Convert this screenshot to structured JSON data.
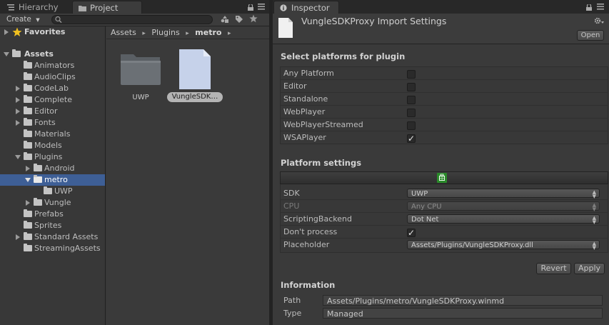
{
  "tabs": {
    "hierarchy": "Hierarchy",
    "project": "Project",
    "inspector": "Inspector"
  },
  "project_toolbar": {
    "create_label": "Create"
  },
  "tree": {
    "favorites": "Favorites",
    "assets": "Assets",
    "items": [
      {
        "label": "Animators"
      },
      {
        "label": "AudioClips"
      },
      {
        "label": "CodeLab"
      },
      {
        "label": "Complete"
      },
      {
        "label": "Editor"
      },
      {
        "label": "Fonts"
      },
      {
        "label": "Materials"
      },
      {
        "label": "Models"
      },
      {
        "label": "Plugins"
      },
      {
        "label": "Android"
      },
      {
        "label": "metro"
      },
      {
        "label": "UWP"
      },
      {
        "label": "Vungle"
      },
      {
        "label": "Prefabs"
      },
      {
        "label": "Sprites"
      },
      {
        "label": "Standard Assets"
      },
      {
        "label": "StreamingAssets"
      }
    ]
  },
  "breadcrumb": {
    "parts": [
      "Assets",
      "Plugins",
      "metro"
    ],
    "separator": "▸"
  },
  "project_items": [
    {
      "label": "UWP",
      "icon": "folder-icon"
    },
    {
      "label": "VungleSDK…",
      "icon": "file-icon",
      "selected": true
    }
  ],
  "inspector": {
    "title": "VungleSDKProxy Import Settings",
    "open_button": "Open",
    "select_platforms_heading": "Select platforms for plugin",
    "platforms": [
      {
        "label": "Any Platform",
        "checked": false
      },
      {
        "label": "Editor",
        "checked": false
      },
      {
        "label": "Standalone",
        "checked": false
      },
      {
        "label": "WebPlayer",
        "checked": false
      },
      {
        "label": "WebPlayerStreamed",
        "checked": false
      },
      {
        "label": "WSAPlayer",
        "checked": true
      }
    ],
    "platform_settings_heading": "Platform settings",
    "settings": {
      "sdk_label": "SDK",
      "sdk_value": "UWP",
      "cpu_label": "CPU",
      "cpu_value": "Any CPU",
      "scripting_label": "ScriptingBackend",
      "scripting_value": "Dot Net",
      "dont_process_label": "Don't process",
      "dont_process_checked": true,
      "placeholder_label": "Placeholder",
      "placeholder_value": "Assets/Plugins/VungleSDKProxy.dll"
    },
    "revert_button": "Revert",
    "apply_button": "Apply",
    "information_heading": "Information",
    "path_label": "Path",
    "path_value": "Assets/Plugins/metro/VungleSDKProxy.winmd",
    "type_label": "Type",
    "type_value": "Managed"
  },
  "colors": {
    "selection": "#3e5f96",
    "windows_store_icon": "#2a8a2a"
  }
}
